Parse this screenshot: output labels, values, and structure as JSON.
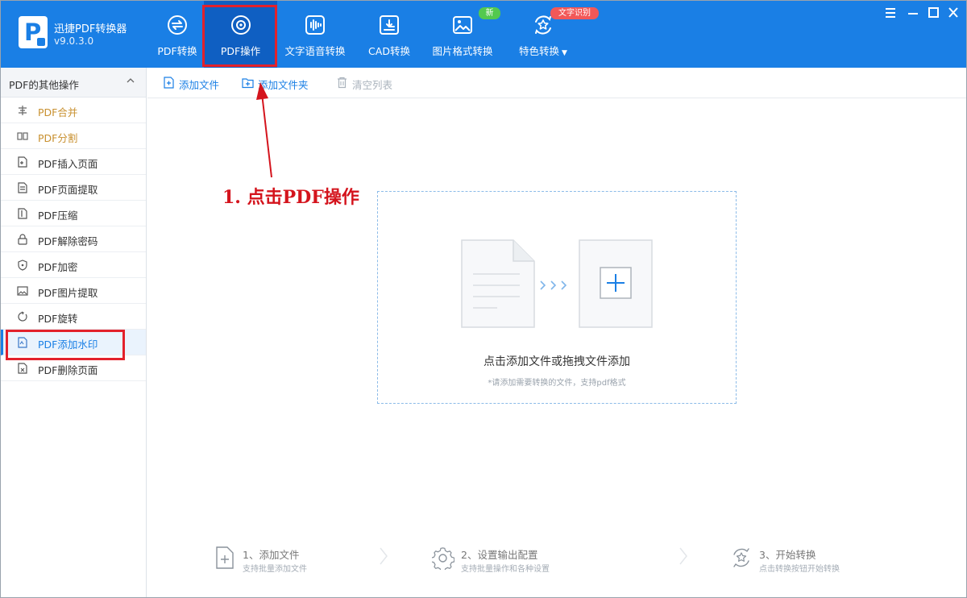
{
  "app": {
    "name": "迅捷PDF转换器",
    "version": "v9.0.3.0"
  },
  "nav": {
    "tabs": [
      {
        "label": "PDF转换",
        "icon": "pdf-convert-icon"
      },
      {
        "label": "PDF操作",
        "icon": "pdf-operate-icon",
        "active": true
      },
      {
        "label": "文字语音转换",
        "icon": "voice-convert-icon"
      },
      {
        "label": "CAD转换",
        "icon": "cad-convert-icon"
      },
      {
        "label": "图片格式转换",
        "icon": "image-convert-icon"
      },
      {
        "label": "特色转换",
        "icon": "special-convert-icon",
        "dropdown": true
      }
    ],
    "badge_new": "新",
    "badge_ocr": "文字识别"
  },
  "window": {
    "controls": [
      "menu-icon",
      "minimize-icon",
      "maximize-icon",
      "close-icon"
    ]
  },
  "sidebar": {
    "header": "PDF的其他操作",
    "items": [
      {
        "label": "PDF合并",
        "icon": "merge-icon"
      },
      {
        "label": "PDF分割",
        "icon": "split-icon"
      },
      {
        "label": "PDF插入页面",
        "icon": "insert-page-icon"
      },
      {
        "label": "PDF页面提取",
        "icon": "extract-page-icon"
      },
      {
        "label": "PDF压缩",
        "icon": "compress-icon"
      },
      {
        "label": "PDF解除密码",
        "icon": "unlock-icon"
      },
      {
        "label": "PDF加密",
        "icon": "shield-icon"
      },
      {
        "label": "PDF图片提取",
        "icon": "image-extract-icon"
      },
      {
        "label": "PDF旋转",
        "icon": "rotate-icon"
      },
      {
        "label": "PDF添加水印",
        "icon": "watermark-icon"
      },
      {
        "label": "PDF删除页面",
        "icon": "delete-page-icon"
      }
    ]
  },
  "toolbar": {
    "add_file": "添加文件",
    "add_folder": "添加文件夹",
    "clear_list": "清空列表"
  },
  "annotation": "1. 点击PDF操作",
  "dropzone": {
    "title": "点击添加文件或拖拽文件添加",
    "subtitle": "*请添加需要转换的文件，支持pdf格式"
  },
  "steps": [
    {
      "title": "1、添加文件",
      "subtitle": "支持批量添加文件",
      "icon": "add-file-step-icon"
    },
    {
      "title": "2、设置输出配置",
      "subtitle": "支持批量操作和各种设置",
      "icon": "settings-gear-icon"
    },
    {
      "title": "3、开始转换",
      "subtitle": "点击转换按钮开始转换",
      "icon": "start-convert-icon"
    }
  ],
  "colors": {
    "topbar": "#1a7fe5",
    "active_tab": "#0f5fc2",
    "accent": "#1a7fe5",
    "highlight_red": "#e3212b",
    "annotation_red": "#d4141d",
    "badge_new_green": "#53c94f",
    "badge_ocr_red": "#f25858",
    "sidebar_orange": "#c8902f"
  }
}
